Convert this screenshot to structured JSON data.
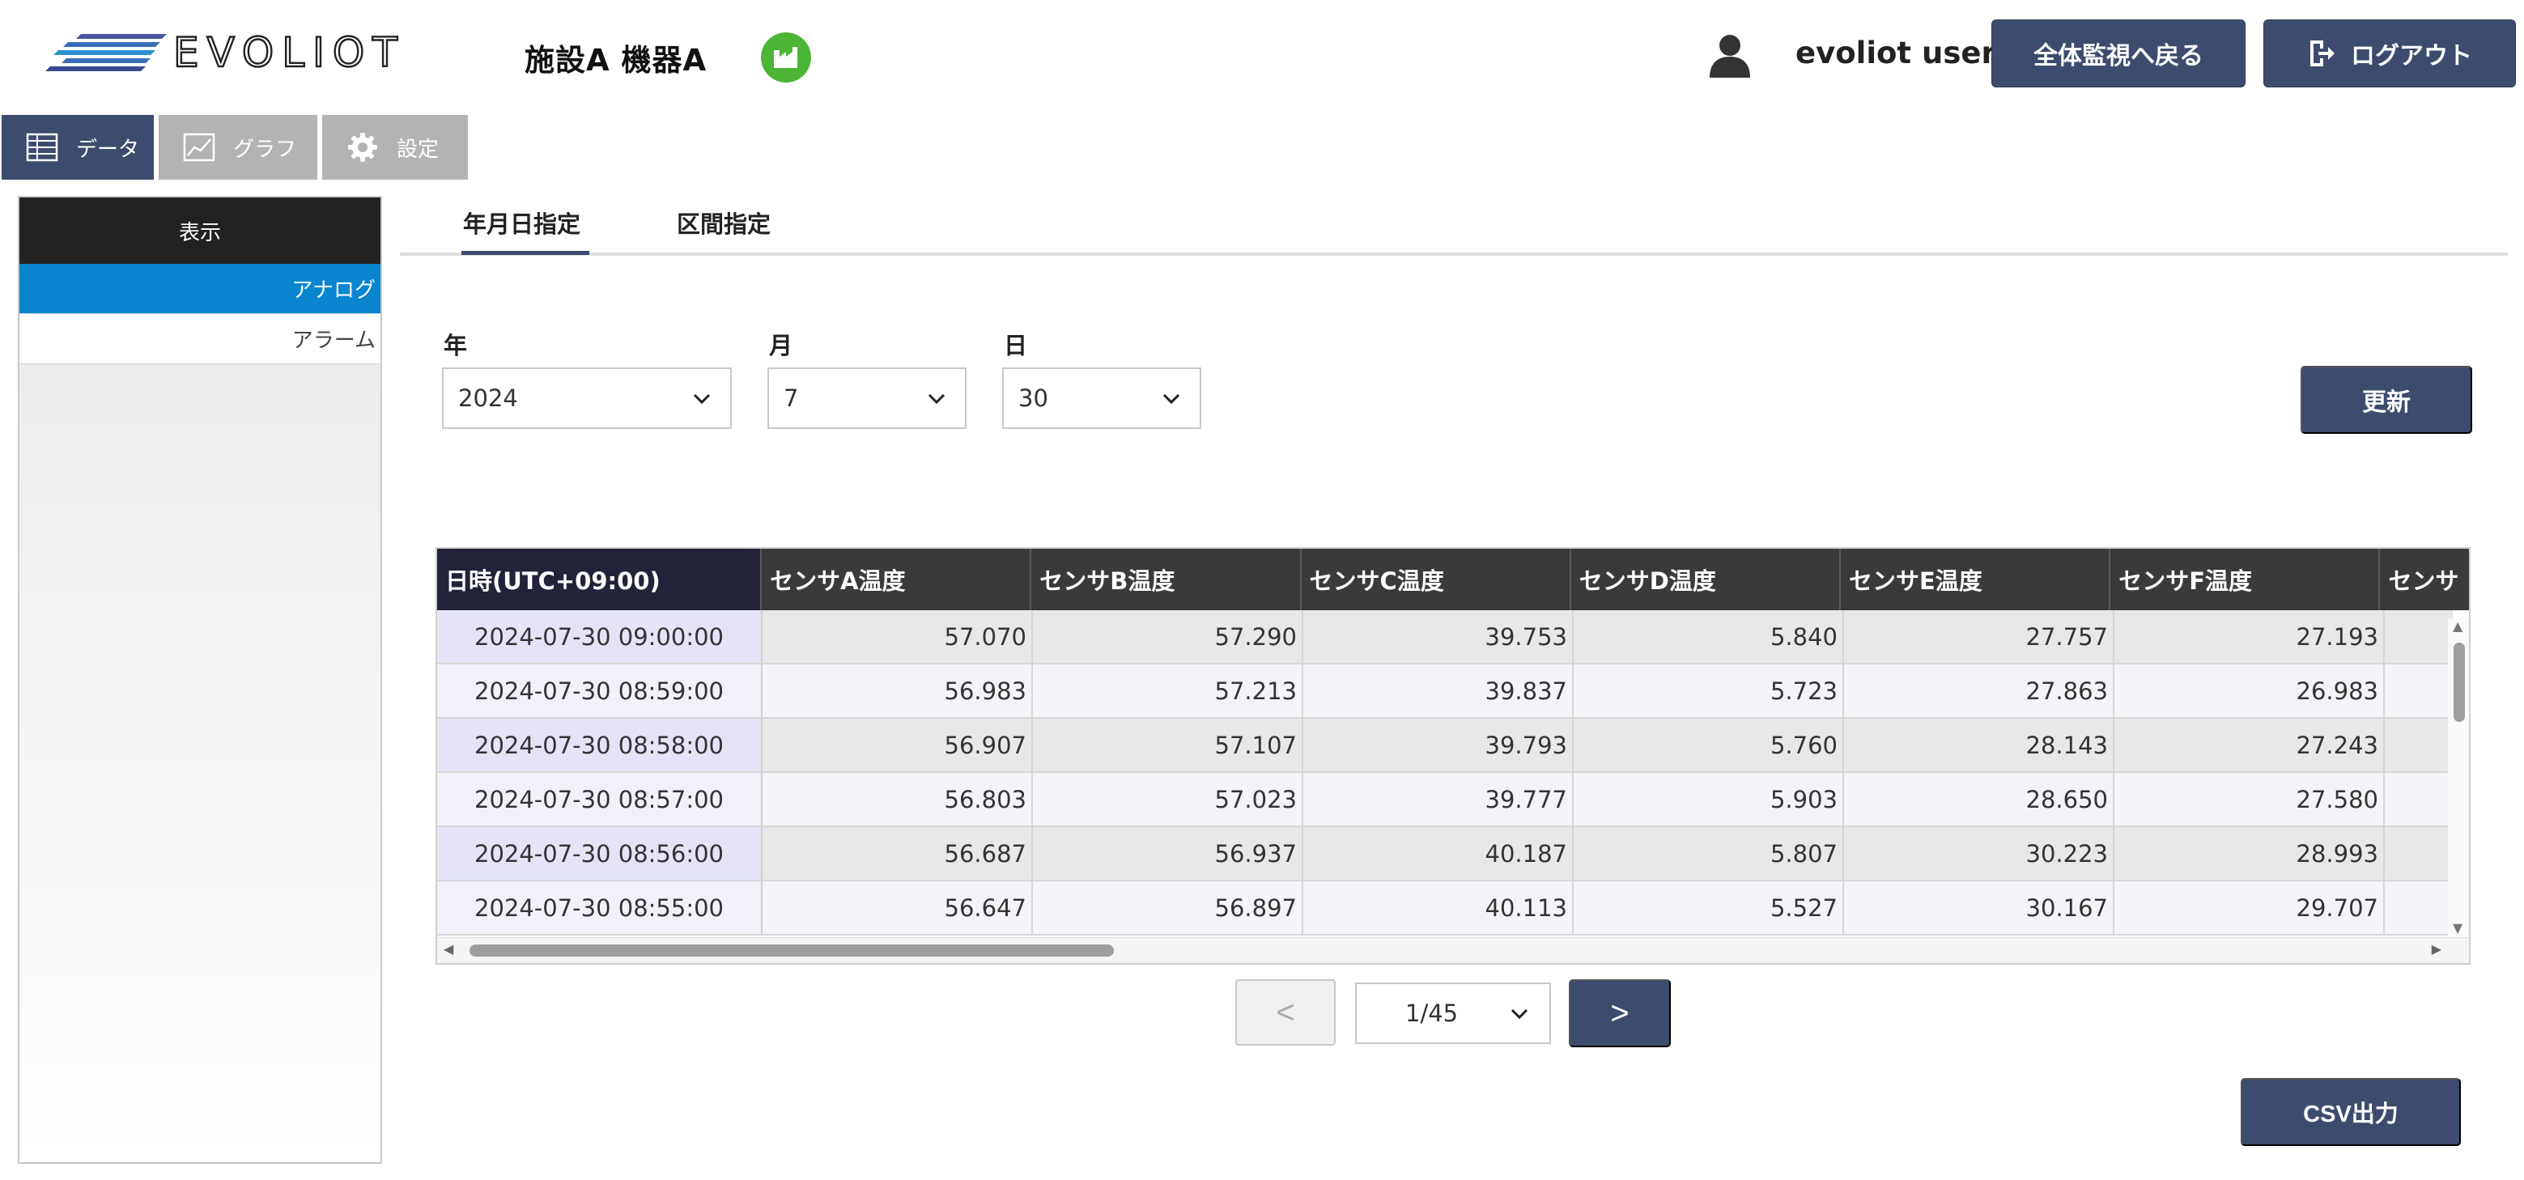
{
  "header": {
    "logo_text": "EVOLIOT",
    "title": "施設A 機器A",
    "factory_icon": "factory-icon",
    "user_name": "evoliot user",
    "back_button": "全体監視へ戻る",
    "logout_button": "ログアウト",
    "colors": {
      "brand_navy": "#3d4b6e",
      "factory_green": "#4cb536",
      "accent_blue": "#0a86d0"
    }
  },
  "main_tabs": [
    {
      "label": "データ",
      "icon": "table-icon",
      "active": true
    },
    {
      "label": "グラフ",
      "icon": "chart-icon",
      "active": false
    },
    {
      "label": "設定",
      "icon": "gear-icon",
      "active": false
    }
  ],
  "sidebar": {
    "header": "表示",
    "items": [
      {
        "label": "アナログ",
        "active": true
      },
      {
        "label": "アラーム",
        "active": false
      }
    ]
  },
  "date_tabs": [
    {
      "label": "年月日指定",
      "active": true
    },
    {
      "label": "区間指定",
      "active": false
    }
  ],
  "filters": {
    "year": {
      "label": "年",
      "value": "2024"
    },
    "month": {
      "label": "月",
      "value": "7"
    },
    "day": {
      "label": "日",
      "value": "30"
    },
    "refresh_button": "更新"
  },
  "table": {
    "headers": [
      "日時(UTC+09:00)",
      "センサA温度",
      "センサB温度",
      "センサC温度",
      "センサD温度",
      "センサE温度",
      "センサF温度",
      "センサ"
    ],
    "rows": [
      [
        "2024-07-30 09:00:00",
        "57.070",
        "57.290",
        "39.753",
        "5.840",
        "27.757",
        "27.193"
      ],
      [
        "2024-07-30 08:59:00",
        "56.983",
        "57.213",
        "39.837",
        "5.723",
        "27.863",
        "26.983"
      ],
      [
        "2024-07-30 08:58:00",
        "56.907",
        "57.107",
        "39.793",
        "5.760",
        "28.143",
        "27.243"
      ],
      [
        "2024-07-30 08:57:00",
        "56.803",
        "57.023",
        "39.777",
        "5.903",
        "28.650",
        "27.580"
      ],
      [
        "2024-07-30 08:56:00",
        "56.687",
        "56.937",
        "40.187",
        "5.807",
        "30.223",
        "28.993"
      ],
      [
        "2024-07-30 08:55:00",
        "56.647",
        "56.897",
        "40.113",
        "5.527",
        "30.167",
        "29.707"
      ]
    ]
  },
  "pagination": {
    "prev": "<",
    "page": "1/45",
    "next": ">"
  },
  "csv_button": "CSV出力"
}
